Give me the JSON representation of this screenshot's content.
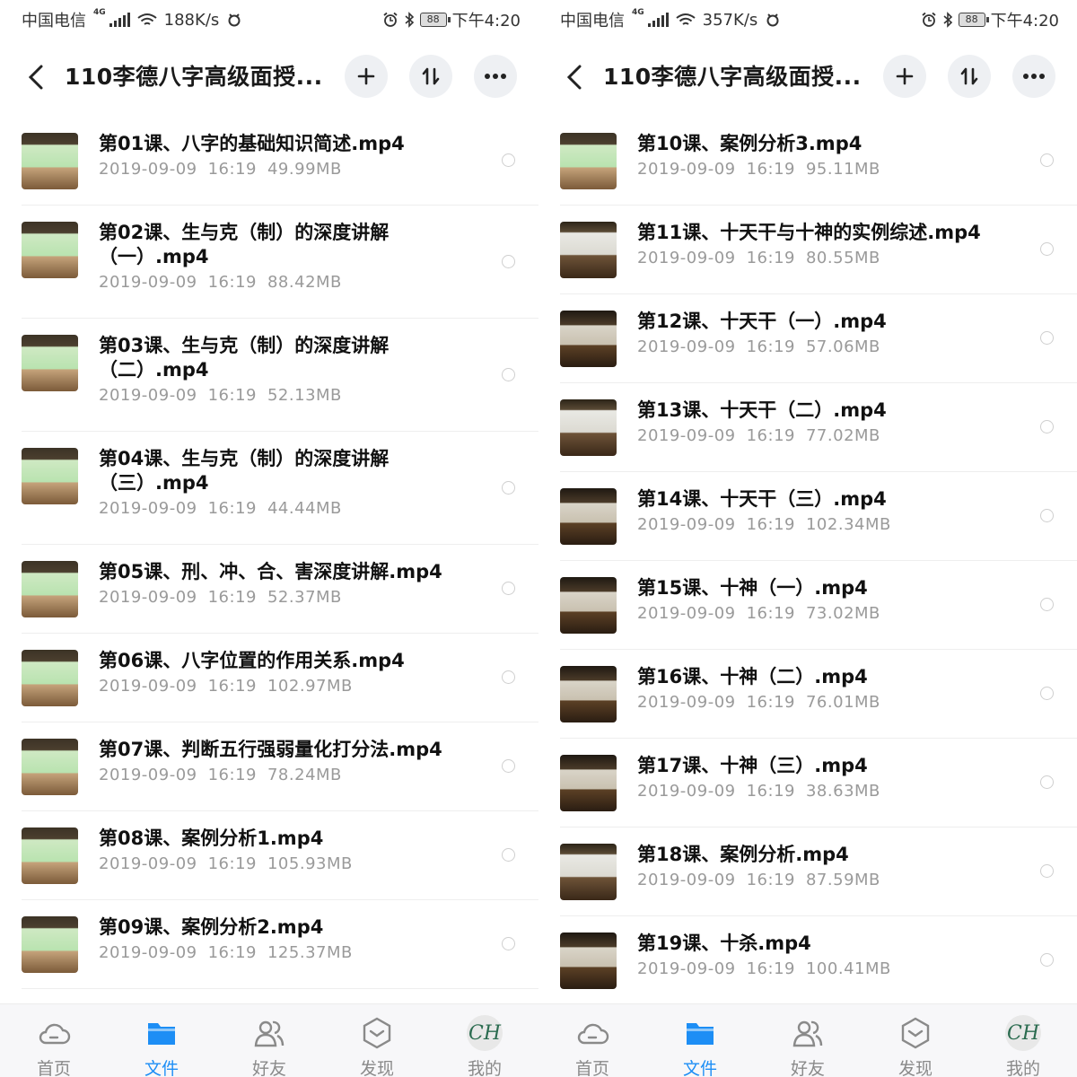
{
  "screens": [
    {
      "status": {
        "carrier": "中国电信",
        "net_gen": "4G",
        "speed": "188K/s",
        "battery": "88",
        "time": "下午4:20"
      },
      "header": {
        "title": "110李德八字高级面授..."
      },
      "files": [
        {
          "name": "第01课、八字的基础知识简述.mp4",
          "date": "2019-09-09",
          "time": "16:19",
          "size": "49.99MB",
          "thumb": "green"
        },
        {
          "name": "第02课、生与克（制）的深度讲解（一）.mp4",
          "date": "2019-09-09",
          "time": "16:19",
          "size": "88.42MB",
          "thumb": "green"
        },
        {
          "name": "第03课、生与克（制）的深度讲解（二）.mp4",
          "date": "2019-09-09",
          "time": "16:19",
          "size": "52.13MB",
          "thumb": "green"
        },
        {
          "name": "第04课、生与克（制）的深度讲解（三）.mp4",
          "date": "2019-09-09",
          "time": "16:19",
          "size": "44.44MB",
          "thumb": "green"
        },
        {
          "name": "第05课、刑、冲、合、害深度讲解.mp4",
          "date": "2019-09-09",
          "time": "16:19",
          "size": "52.37MB",
          "thumb": "green"
        },
        {
          "name": "第06课、八字位置的作用关系.mp4",
          "date": "2019-09-09",
          "time": "16:19",
          "size": "102.97MB",
          "thumb": "green"
        },
        {
          "name": "第07课、判断五行强弱量化打分法.mp4",
          "date": "2019-09-09",
          "time": "16:19",
          "size": "78.24MB",
          "thumb": "green"
        },
        {
          "name": "第08课、案例分析1.mp4",
          "date": "2019-09-09",
          "time": "16:19",
          "size": "105.93MB",
          "thumb": "green"
        },
        {
          "name": "第09课、案例分析2.mp4",
          "date": "2019-09-09",
          "time": "16:19",
          "size": "125.37MB",
          "thumb": "green"
        }
      ]
    },
    {
      "status": {
        "carrier": "中国电信",
        "net_gen": "4G",
        "speed": "357K/s",
        "battery": "88",
        "time": "下午4:20"
      },
      "header": {
        "title": "110李德八字高级面授..."
      },
      "files": [
        {
          "name": "第10课、案例分析3.mp4",
          "date": "2019-09-09",
          "time": "16:19",
          "size": "95.11MB",
          "thumb": "green"
        },
        {
          "name": "第11课、十天干与十神的实例综述.mp4",
          "date": "2019-09-09",
          "time": "16:19",
          "size": "80.55MB",
          "thumb": "board"
        },
        {
          "name": "第12课、十天干（一）.mp4",
          "date": "2019-09-09",
          "time": "16:19",
          "size": "57.06MB",
          "thumb": "dark"
        },
        {
          "name": "第13课、十天干（二）.mp4",
          "date": "2019-09-09",
          "time": "16:19",
          "size": "77.02MB",
          "thumb": "board"
        },
        {
          "name": "第14课、十天干（三）.mp4",
          "date": "2019-09-09",
          "time": "16:19",
          "size": "102.34MB",
          "thumb": "dark"
        },
        {
          "name": "第15课、十神（一）.mp4",
          "date": "2019-09-09",
          "time": "16:19",
          "size": "73.02MB",
          "thumb": "dark"
        },
        {
          "name": "第16课、十神（二）.mp4",
          "date": "2019-09-09",
          "time": "16:19",
          "size": "76.01MB",
          "thumb": "dark"
        },
        {
          "name": "第17课、十神（三）.mp4",
          "date": "2019-09-09",
          "time": "16:19",
          "size": "38.63MB",
          "thumb": "dark"
        },
        {
          "name": "第18课、案例分析.mp4",
          "date": "2019-09-09",
          "time": "16:19",
          "size": "87.59MB",
          "thumb": "board"
        },
        {
          "name": "第19课、十杀.mp4",
          "date": "2019-09-09",
          "time": "16:19",
          "size": "100.41MB",
          "thumb": "dark"
        }
      ]
    }
  ],
  "tabs": [
    {
      "label": "首页",
      "icon": "cloud-icon"
    },
    {
      "label": "文件",
      "icon": "folder-icon",
      "active": true
    },
    {
      "label": "好友",
      "icon": "friends-icon"
    },
    {
      "label": "发现",
      "icon": "discover-icon"
    },
    {
      "label": "我的",
      "icon": "avatar-icon",
      "avatar_text": "CH"
    }
  ],
  "colors": {
    "accent": "#1d8ef5",
    "meta_text": "#9a9a9a",
    "tab_inactive": "#8a8a8a"
  }
}
